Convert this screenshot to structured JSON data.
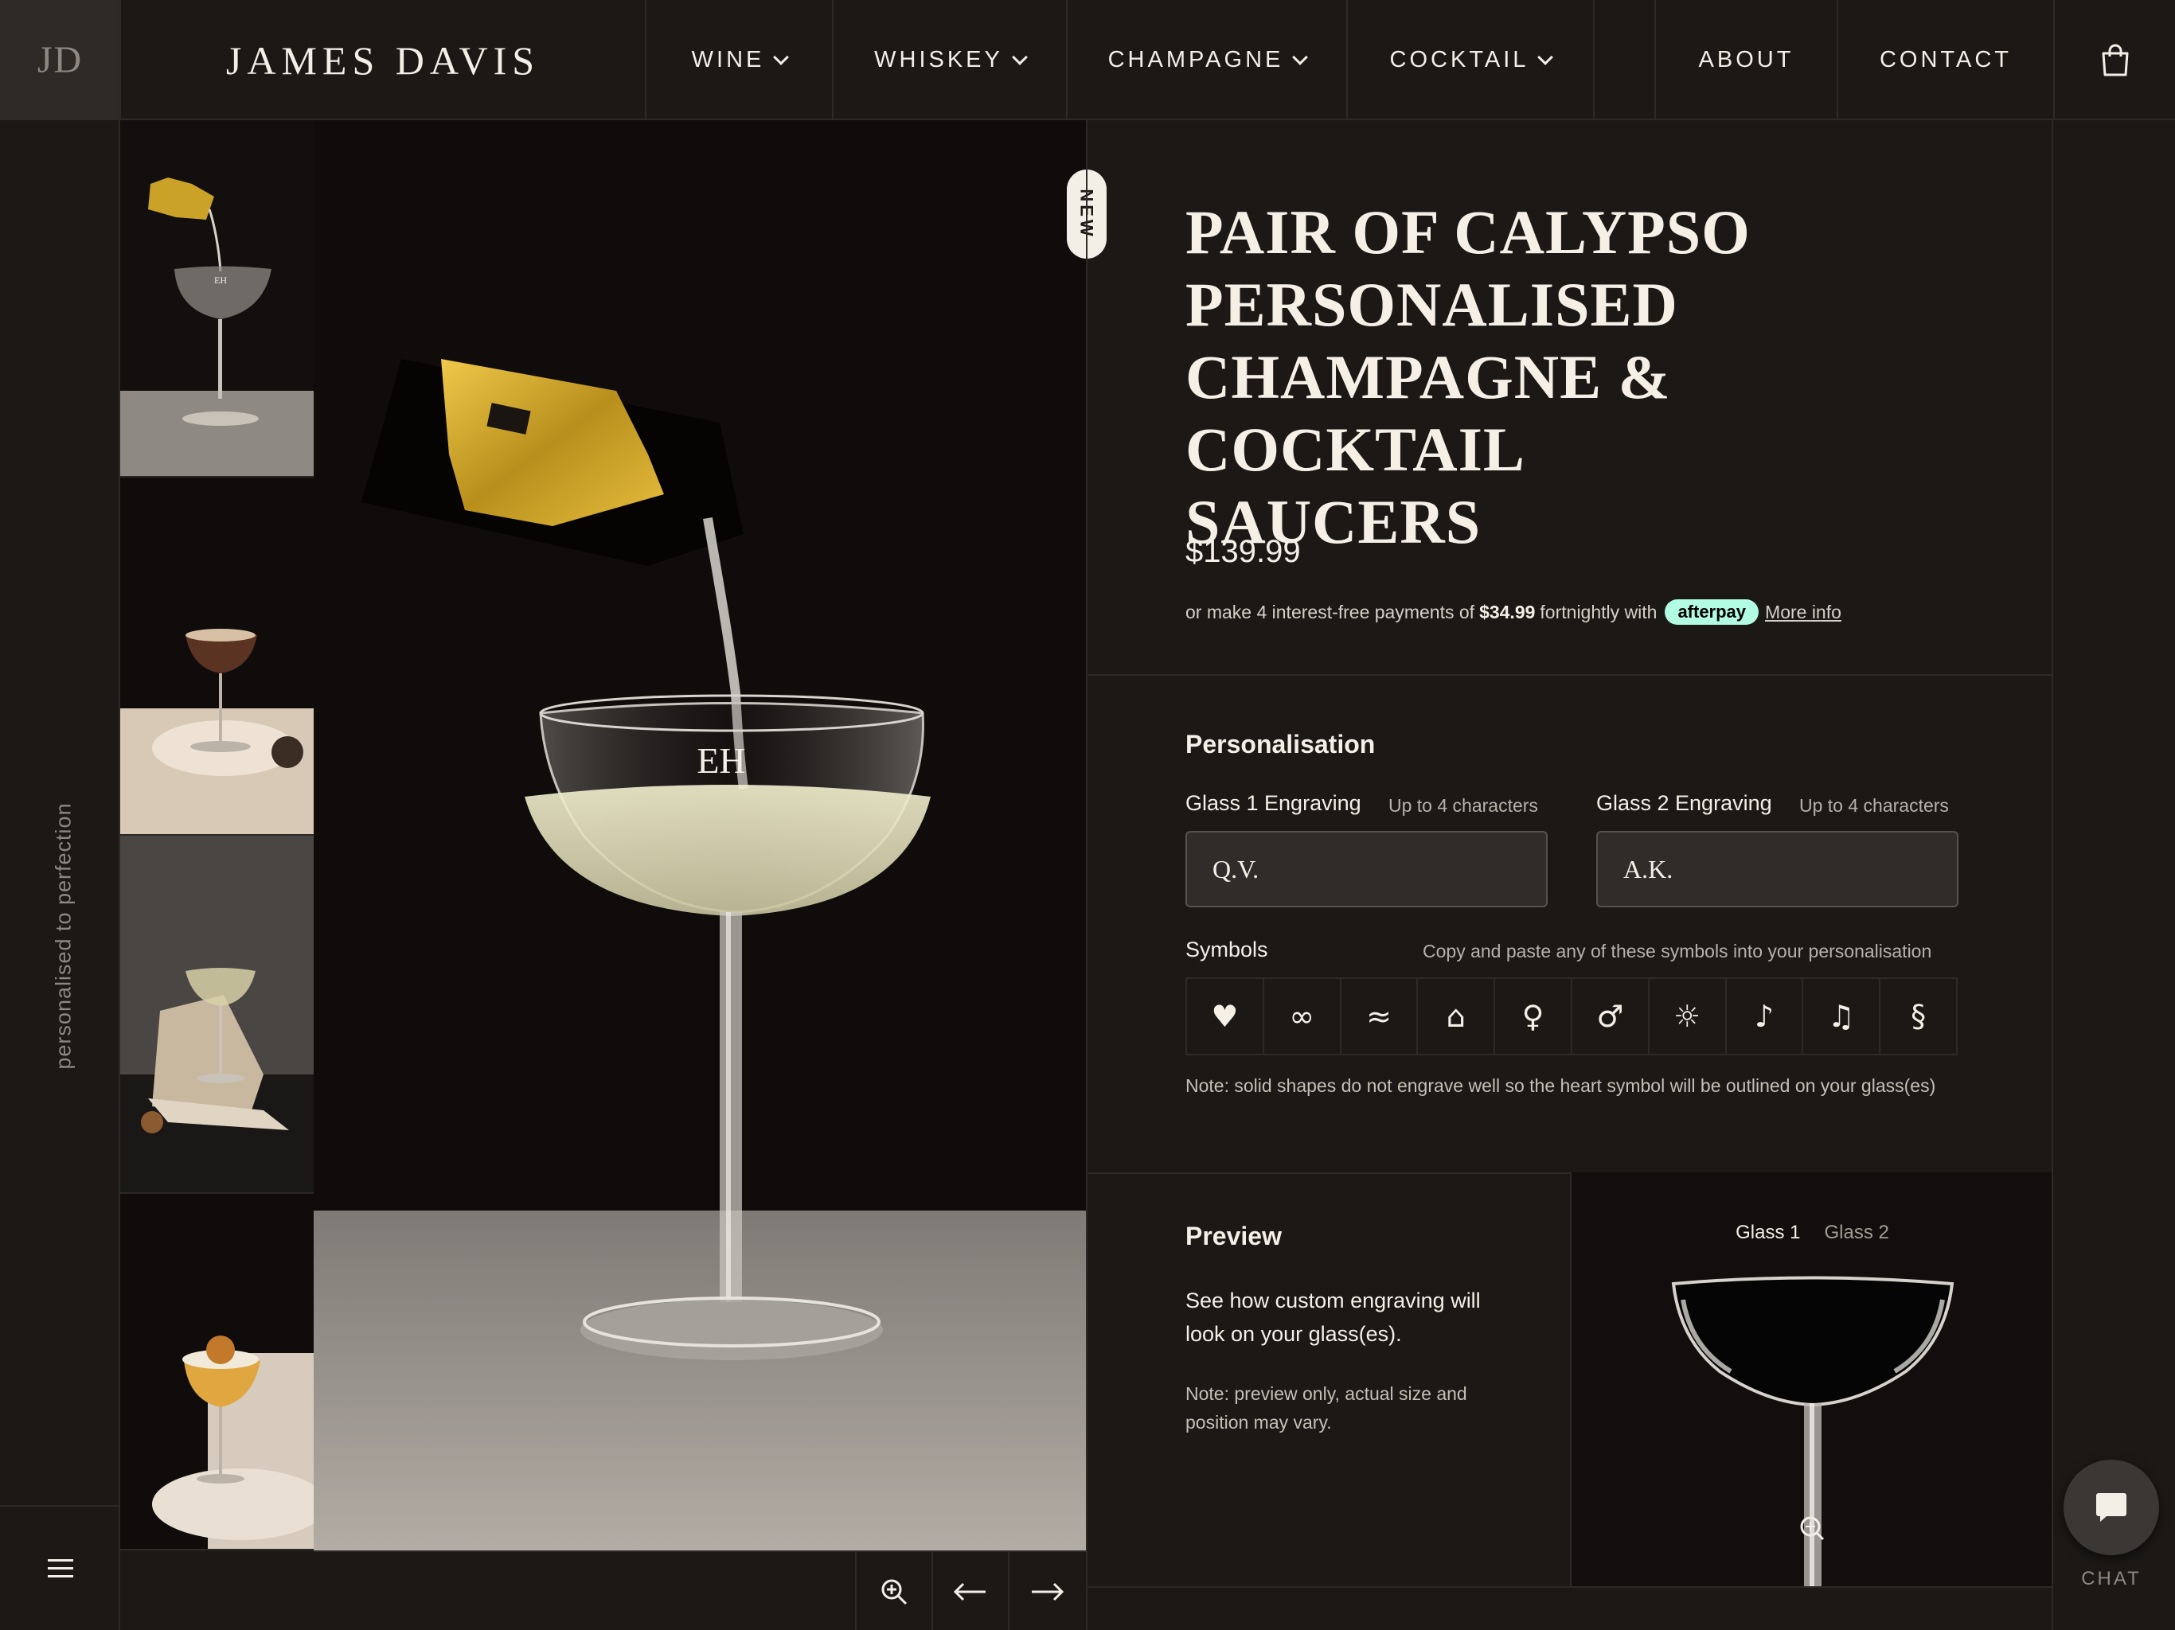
{
  "header": {
    "logo": "JD",
    "brand": "JAMES DAVIS",
    "nav": [
      {
        "label": "WINE",
        "dropdown": true
      },
      {
        "label": "WHISKEY",
        "dropdown": true
      },
      {
        "label": "CHAMPAGNE",
        "dropdown": true
      },
      {
        "label": "COCKTAIL",
        "dropdown": true
      },
      {
        "label": "ABOUT",
        "dropdown": false
      },
      {
        "label": "CONTACT",
        "dropdown": false
      }
    ],
    "cart_icon": "shopping-bag-icon"
  },
  "rail": {
    "tagline": "personalised to perfection",
    "menu_icon": "hamburger-menu-icon"
  },
  "gallery": {
    "badge": "NEW",
    "engraving_on_image": "EH",
    "thumbnails": [
      {
        "alt": "champagne pouring into saucer"
      },
      {
        "alt": "espresso martini in saucer"
      },
      {
        "alt": "saucer on stone"
      },
      {
        "alt": "whiskey sour in saucer"
      }
    ],
    "controls": [
      "zoom-in-icon",
      "arrow-left-icon",
      "arrow-right-icon"
    ]
  },
  "product": {
    "title_lines": [
      "PAIR OF CALYPSO",
      "PERSONALISED",
      "CHAMPAGNE & COCKTAIL",
      "SAUCERS"
    ],
    "price": "$139.99",
    "afterpay": {
      "prefix": "or make 4 interest-free payments of",
      "amount": "$34.99",
      "suffix": "fortnightly with",
      "badge": "afterpay",
      "link": "More info"
    }
  },
  "personalisation": {
    "heading": "Personalisation",
    "glass1": {
      "label": "Glass 1 Engraving",
      "hint": "Up to 4 characters",
      "value": "Q.V."
    },
    "glass2": {
      "label": "Glass 2 Engraving",
      "hint": "Up to 4 characters",
      "value": "A.K."
    },
    "symbols_label": "Symbols",
    "symbols_hint": "Copy and paste any of these symbols into your personalisation",
    "symbols": [
      "♥",
      "∞",
      "≈",
      "⌂",
      "♀",
      "♂",
      "☼",
      "♪",
      "♫",
      "§"
    ],
    "note": "Note: solid shapes do not engrave well so the heart symbol will be outlined on your glass(es)"
  },
  "preview": {
    "heading": "Preview",
    "description": "See how custom engraving will look on your glass(es).",
    "note": "Note: preview only, actual size and position may vary.",
    "tabs": [
      "Glass 1",
      "Glass 2"
    ],
    "active_tab": "Glass 1"
  },
  "chat": {
    "label": "CHAT"
  },
  "colors": {
    "background": "#1b1816",
    "border": "#2d2926",
    "text": "#f3eee6",
    "muted": "#8d8780",
    "afterpay": "#b2fce4",
    "gold": "#c9a227"
  }
}
